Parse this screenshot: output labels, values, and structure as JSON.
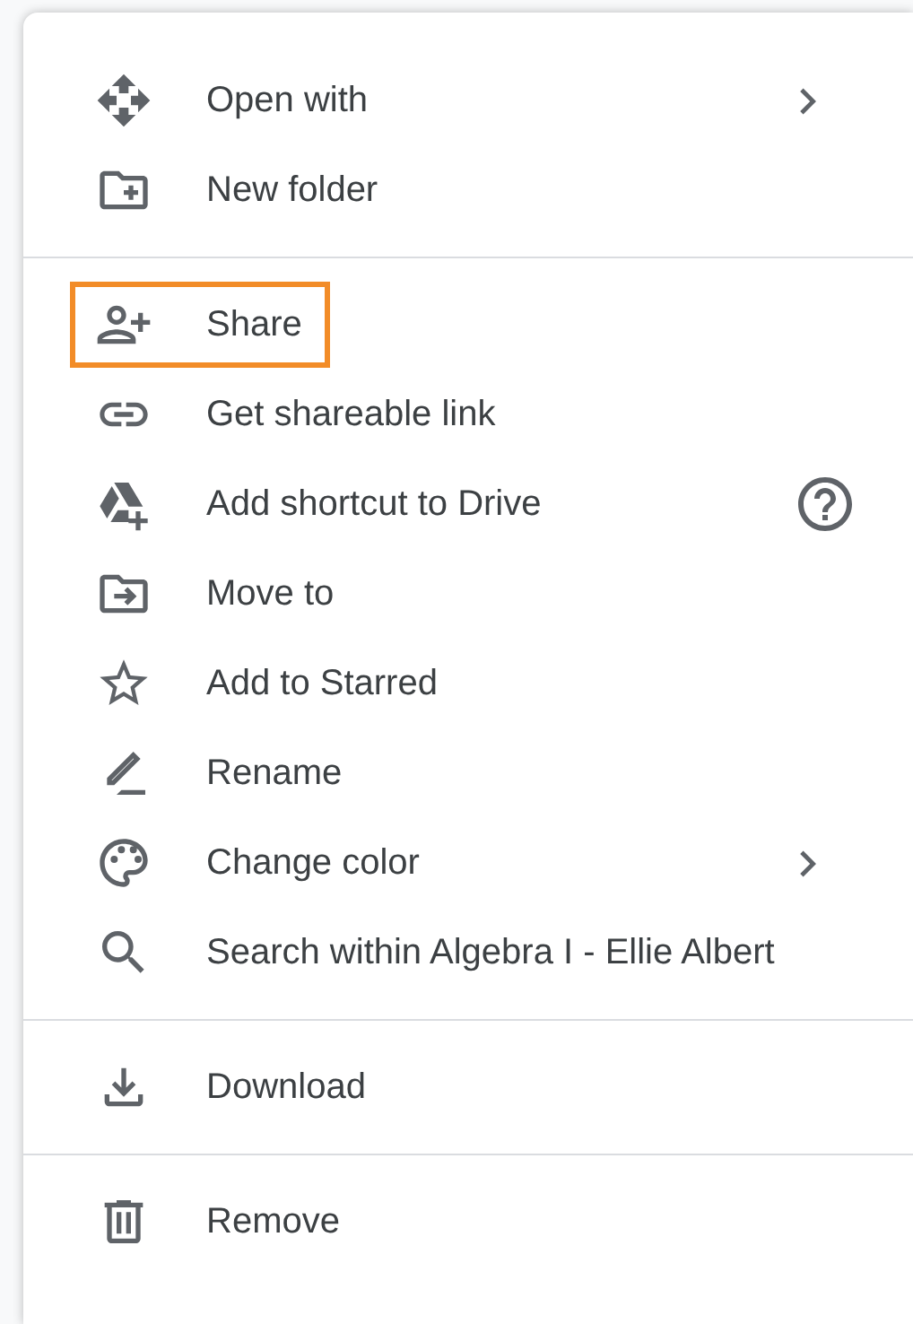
{
  "menu": {
    "sections": [
      {
        "items": [
          {
            "label": "Open with",
            "submenu": true,
            "help": false,
            "highlighted": false
          },
          {
            "label": "New folder",
            "submenu": false,
            "help": false,
            "highlighted": false
          }
        ]
      },
      {
        "items": [
          {
            "label": "Share",
            "submenu": false,
            "help": false,
            "highlighted": true
          },
          {
            "label": "Get shareable link",
            "submenu": false,
            "help": false,
            "highlighted": false
          },
          {
            "label": "Add shortcut to Drive",
            "submenu": false,
            "help": true,
            "highlighted": false
          },
          {
            "label": "Move to",
            "submenu": false,
            "help": false,
            "highlighted": false
          },
          {
            "label": "Add to Starred",
            "submenu": false,
            "help": false,
            "highlighted": false
          },
          {
            "label": "Rename",
            "submenu": false,
            "help": false,
            "highlighted": false
          },
          {
            "label": "Change color",
            "submenu": true,
            "help": false,
            "highlighted": false
          },
          {
            "label": "Search within Algebra I - Ellie Albert",
            "submenu": false,
            "help": false,
            "highlighted": false
          }
        ]
      },
      {
        "items": [
          {
            "label": "Download",
            "submenu": false,
            "help": false,
            "highlighted": false
          }
        ]
      },
      {
        "items": [
          {
            "label": "Remove",
            "submenu": false,
            "help": false,
            "highlighted": false
          }
        ]
      }
    ]
  }
}
